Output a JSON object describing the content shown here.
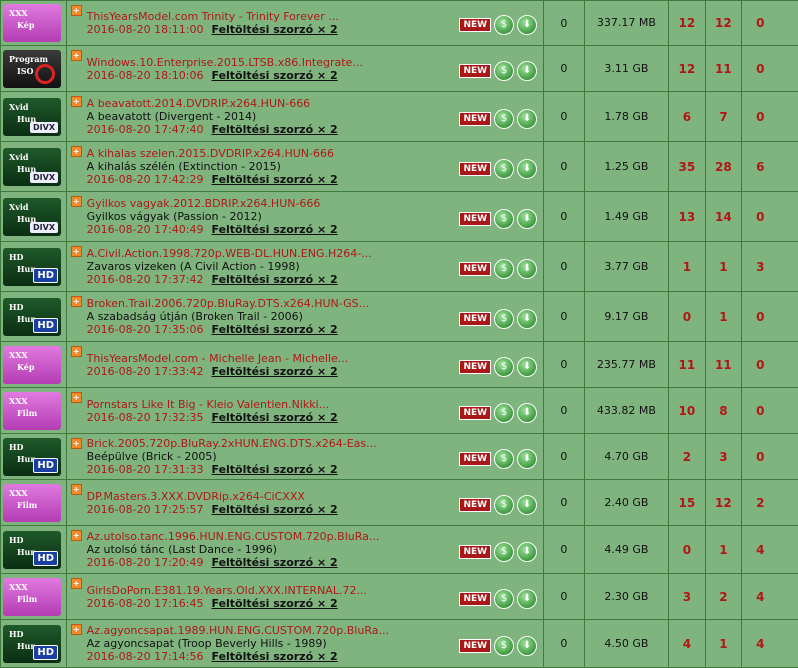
{
  "labels": {
    "new": "NEW",
    "multiplier": "Feltöltési szorzó × 2",
    "bag_icon": "money-bag-icon",
    "download_icon": "download-icon"
  },
  "rows": [
    {
      "cat": "xxx",
      "cat_t1": "XXX",
      "cat_t2": "Kép",
      "cat_logo": "",
      "title": "ThisYearsModel.com Trinity - Trinity Forever ...",
      "sub": "",
      "date": "2016-08-20 18:11:00",
      "c0": "0",
      "size": "337.17 MB",
      "s": "12",
      "l": "12",
      "c": "0"
    },
    {
      "cat": "prog",
      "cat_t1": "Program",
      "cat_t2": "ISO",
      "cat_logo": "",
      "title": "Windows.10.Enterprise.2015.LTSB.x86.Integrate...",
      "sub": "",
      "date": "2016-08-20 18:10:06",
      "c0": "0",
      "size": "3.11 GB",
      "s": "12",
      "l": "11",
      "c": "0"
    },
    {
      "cat": "xvid",
      "cat_t1": "Xvid",
      "cat_t2": "Hun",
      "cat_logo": "DIVX",
      "title": "A beavatott.2014.DVDRIP.x264.HUN-666",
      "sub": "A beavatott (Divergent - 2014)",
      "date": "2016-08-20 17:47:40",
      "c0": "0",
      "size": "1.78 GB",
      "s": "6",
      "l": "7",
      "c": "0"
    },
    {
      "cat": "xvid",
      "cat_t1": "Xvid",
      "cat_t2": "Hun",
      "cat_logo": "DIVX",
      "title": "A kihalas szelen.2015.DVDRIP.x264.HUN-666",
      "sub": "A kihalás szélén (Extinction - 2015)",
      "date": "2016-08-20 17:42:29",
      "c0": "0",
      "size": "1.25 GB",
      "s": "35",
      "l": "28",
      "c": "6"
    },
    {
      "cat": "xvid",
      "cat_t1": "Xvid",
      "cat_t2": "Hun",
      "cat_logo": "DIVX",
      "title": "Gyilkos vagyak.2012.BDRIP.x264.HUN-666",
      "sub": "Gyilkos vágyak (Passion - 2012)",
      "date": "2016-08-20 17:40:49",
      "c0": "0",
      "size": "1.49 GB",
      "s": "13",
      "l": "14",
      "c": "0"
    },
    {
      "cat": "hd",
      "cat_t1": "HD",
      "cat_t2": "Hun",
      "cat_logo": "HD",
      "title": "A.Civil.Action.1998.720p.WEB-DL.HUN.ENG.H264-...",
      "sub": "Zavaros vizeken (A Civil Action - 1998)",
      "date": "2016-08-20 17:37:42",
      "c0": "0",
      "size": "3.77 GB",
      "s": "1",
      "l": "1",
      "c": "3"
    },
    {
      "cat": "hd",
      "cat_t1": "HD",
      "cat_t2": "Hun",
      "cat_logo": "HD",
      "title": "Broken.Trail.2006.720p.BluRay.DTS.x264.HUN-GS...",
      "sub": "A szabadság útján (Broken Trail - 2006)",
      "date": "2016-08-20 17:35:06",
      "c0": "0",
      "size": "9.17 GB",
      "s": "0",
      "l": "1",
      "c": "0"
    },
    {
      "cat": "xxx",
      "cat_t1": "XXX",
      "cat_t2": "Kép",
      "cat_logo": "",
      "title": "ThisYearsModel.com - Michelle Jean - Michelle...",
      "sub": "",
      "date": "2016-08-20 17:33:42",
      "c0": "0",
      "size": "235.77 MB",
      "s": "11",
      "l": "11",
      "c": "0"
    },
    {
      "cat": "xxx",
      "cat_t1": "XXX",
      "cat_t2": "Film",
      "cat_logo": "",
      "title": "Pornstars Like It Big - Kleio Valentien.Nikki...",
      "sub": "",
      "date": "2016-08-20 17:32:35",
      "c0": "0",
      "size": "433.82 MB",
      "s": "10",
      "l": "8",
      "c": "0"
    },
    {
      "cat": "hd",
      "cat_t1": "HD",
      "cat_t2": "Hun",
      "cat_logo": "HD",
      "title": "Brick.2005.720p.BluRay.2xHUN.ENG.DTS.x264-Eas...",
      "sub": "Beépülve (Brick - 2005)",
      "date": "2016-08-20 17:31:33",
      "c0": "0",
      "size": "4.70 GB",
      "s": "2",
      "l": "3",
      "c": "0"
    },
    {
      "cat": "xxx",
      "cat_t1": "XXX",
      "cat_t2": "Film",
      "cat_logo": "",
      "title": "DP.Masters.3.XXX.DVDRip.x264-CiCXXX",
      "sub": "",
      "date": "2016-08-20 17:25:57",
      "c0": "0",
      "size": "2.40 GB",
      "s": "15",
      "l": "12",
      "c": "2"
    },
    {
      "cat": "hd",
      "cat_t1": "HD",
      "cat_t2": "Hun",
      "cat_logo": "HD",
      "title": "Az.utolso.tanc.1996.HUN.ENG.CUSTOM.720p.BluRa...",
      "sub": "Az utolsó tánc (Last Dance - 1996)",
      "date": "2016-08-20 17:20:49",
      "c0": "0",
      "size": "4.49 GB",
      "s": "0",
      "l": "1",
      "c": "4"
    },
    {
      "cat": "xxx",
      "cat_t1": "XXX",
      "cat_t2": "Film",
      "cat_logo": "",
      "title": "GirlsDoPorn.E381.19.Years.Old.XXX.INTERNAL.72...",
      "sub": "",
      "date": "2016-08-20 17:16:45",
      "c0": "0",
      "size": "2.30 GB",
      "s": "3",
      "l": "2",
      "c": "4"
    },
    {
      "cat": "hd",
      "cat_t1": "HD",
      "cat_t2": "Hun",
      "cat_logo": "HD",
      "title": "Az.agyoncsapat.1989.HUN.ENG.CUSTOM.720p.BluRa...",
      "sub": "Az agyoncsapat (Troop Beverly Hills - 1989)",
      "date": "2016-08-20 17:14:56",
      "c0": "0",
      "size": "4.50 GB",
      "s": "4",
      "l": "1",
      "c": "4"
    }
  ]
}
